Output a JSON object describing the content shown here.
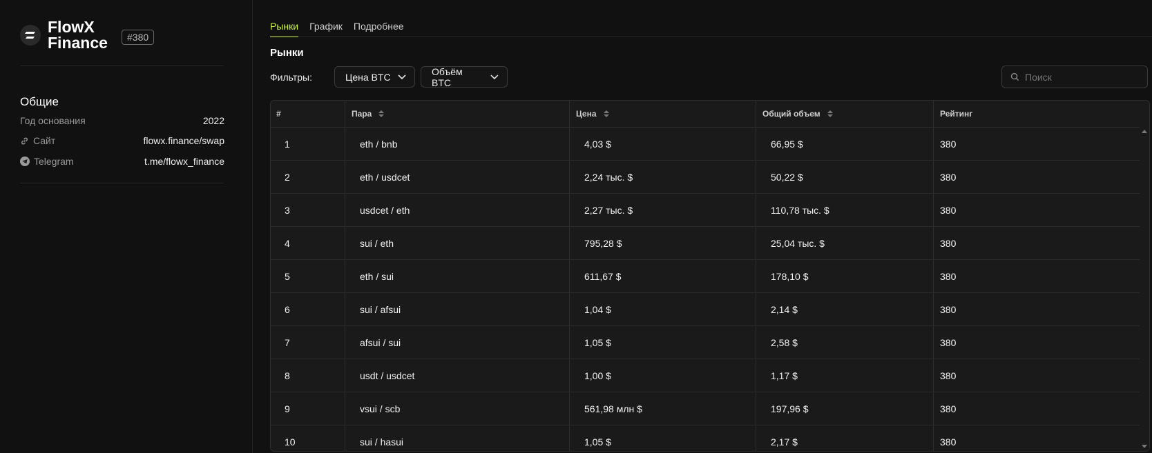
{
  "brand": {
    "name_line1": "FlowX",
    "name_line2": "Finance",
    "rank": "#380",
    "logo_icon": "flowx-logo-icon"
  },
  "general": {
    "title": "Общие",
    "founded_label": "Год основания",
    "founded_value": "2022",
    "site_label": "Сайт",
    "site_value": "flowx.finance/swap",
    "telegram_label": "Telegram",
    "telegram_value": "t.me/flowx_finance"
  },
  "tabs": [
    "Рынки",
    "График",
    "Подробнее"
  ],
  "main": {
    "title": "Рынки",
    "filters_label": "Фильтры:",
    "filter_price": "Цена BTC",
    "filter_volume": "Объём BTC",
    "search_placeholder": "Поиск"
  },
  "table": {
    "headers": [
      "#",
      "Пара",
      "Цена",
      "Общий объем",
      "Рейтинг"
    ],
    "rows": [
      [
        "1",
        "eth / bnb",
        "4,03 $",
        "66,95 $",
        "380"
      ],
      [
        "2",
        "eth / usdcet",
        "2,24 тыс. $",
        "50,22 $",
        "380"
      ],
      [
        "3",
        "usdcet / eth",
        "2,27 тыс. $",
        "110,78 тыс. $",
        "380"
      ],
      [
        "4",
        "sui / eth",
        "795,28 $",
        "25,04 тыс. $",
        "380"
      ],
      [
        "5",
        "eth / sui",
        "611,67 $",
        "178,10 $",
        "380"
      ],
      [
        "6",
        "sui / afsui",
        "1,04 $",
        "2,14 $",
        "380"
      ],
      [
        "7",
        "afsui / sui",
        "1,05 $",
        "2,58 $",
        "380"
      ],
      [
        "8",
        "usdt / usdcet",
        "1,00 $",
        "1,17 $",
        "380"
      ],
      [
        "9",
        "vsui / scb",
        "561,98 млн $",
        "197,96 $",
        "380"
      ],
      [
        "10",
        "sui / hasui",
        "1,05 $",
        "2,17 $",
        "380"
      ]
    ]
  },
  "colors": {
    "accent": "#c9f24a",
    "background": "#111111",
    "table_bg": "#1a1a1a"
  }
}
